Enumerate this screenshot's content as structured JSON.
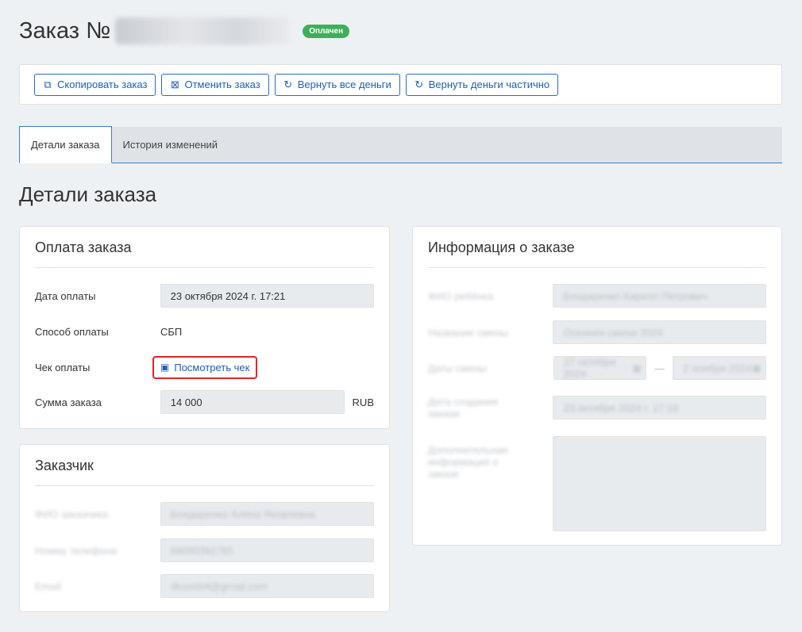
{
  "header": {
    "title": "Заказ №",
    "status_badge": "Оплачен"
  },
  "toolbar": {
    "copy_label": "Скопировать заказ",
    "cancel_label": "Отменить заказ",
    "refund_all_label": "Вернуть все деньги",
    "refund_partial_label": "Вернуть деньги частично"
  },
  "tabs": [
    {
      "label": "Детали заказа",
      "active": true
    },
    {
      "label": "История изменений",
      "active": false
    }
  ],
  "section_title": "Детали заказа",
  "payment": {
    "title": "Оплата заказа",
    "date_label": "Дата оплаты",
    "date_value": "23 октября 2024 г. 17:21",
    "method_label": "Способ оплаты",
    "method_value": "СБП",
    "receipt_label": "Чек оплаты",
    "receipt_link": "Посмотреть чек",
    "sum_label": "Сумма заказа",
    "sum_value": "14 000",
    "currency": "RUB"
  },
  "customer": {
    "title": "Заказчик",
    "name_label": "ФИО заказчика",
    "name_value": "Бондаренко Алёна Яковлевна",
    "phone_label": "Номер телефона",
    "phone_value": "89080392765",
    "email_label": "Email",
    "email_value": "dkorebi4@gmail.com"
  },
  "order_info": {
    "title": "Информация о заказе",
    "child_label": "ФИО ребёнка",
    "child_value": "Бондаренко Кирилл Петрович",
    "shift_label": "Название смены",
    "shift_value": "Осенняя смена 2024",
    "dates_label": "Даты смены",
    "date_from": "27 октября 2024",
    "date_to": "2 ноября 2024",
    "created_label": "Дата создания заказа",
    "created_value": "23 октября 2024 г. 17:18",
    "extra_label": "Дополнительная информация о заказе"
  }
}
